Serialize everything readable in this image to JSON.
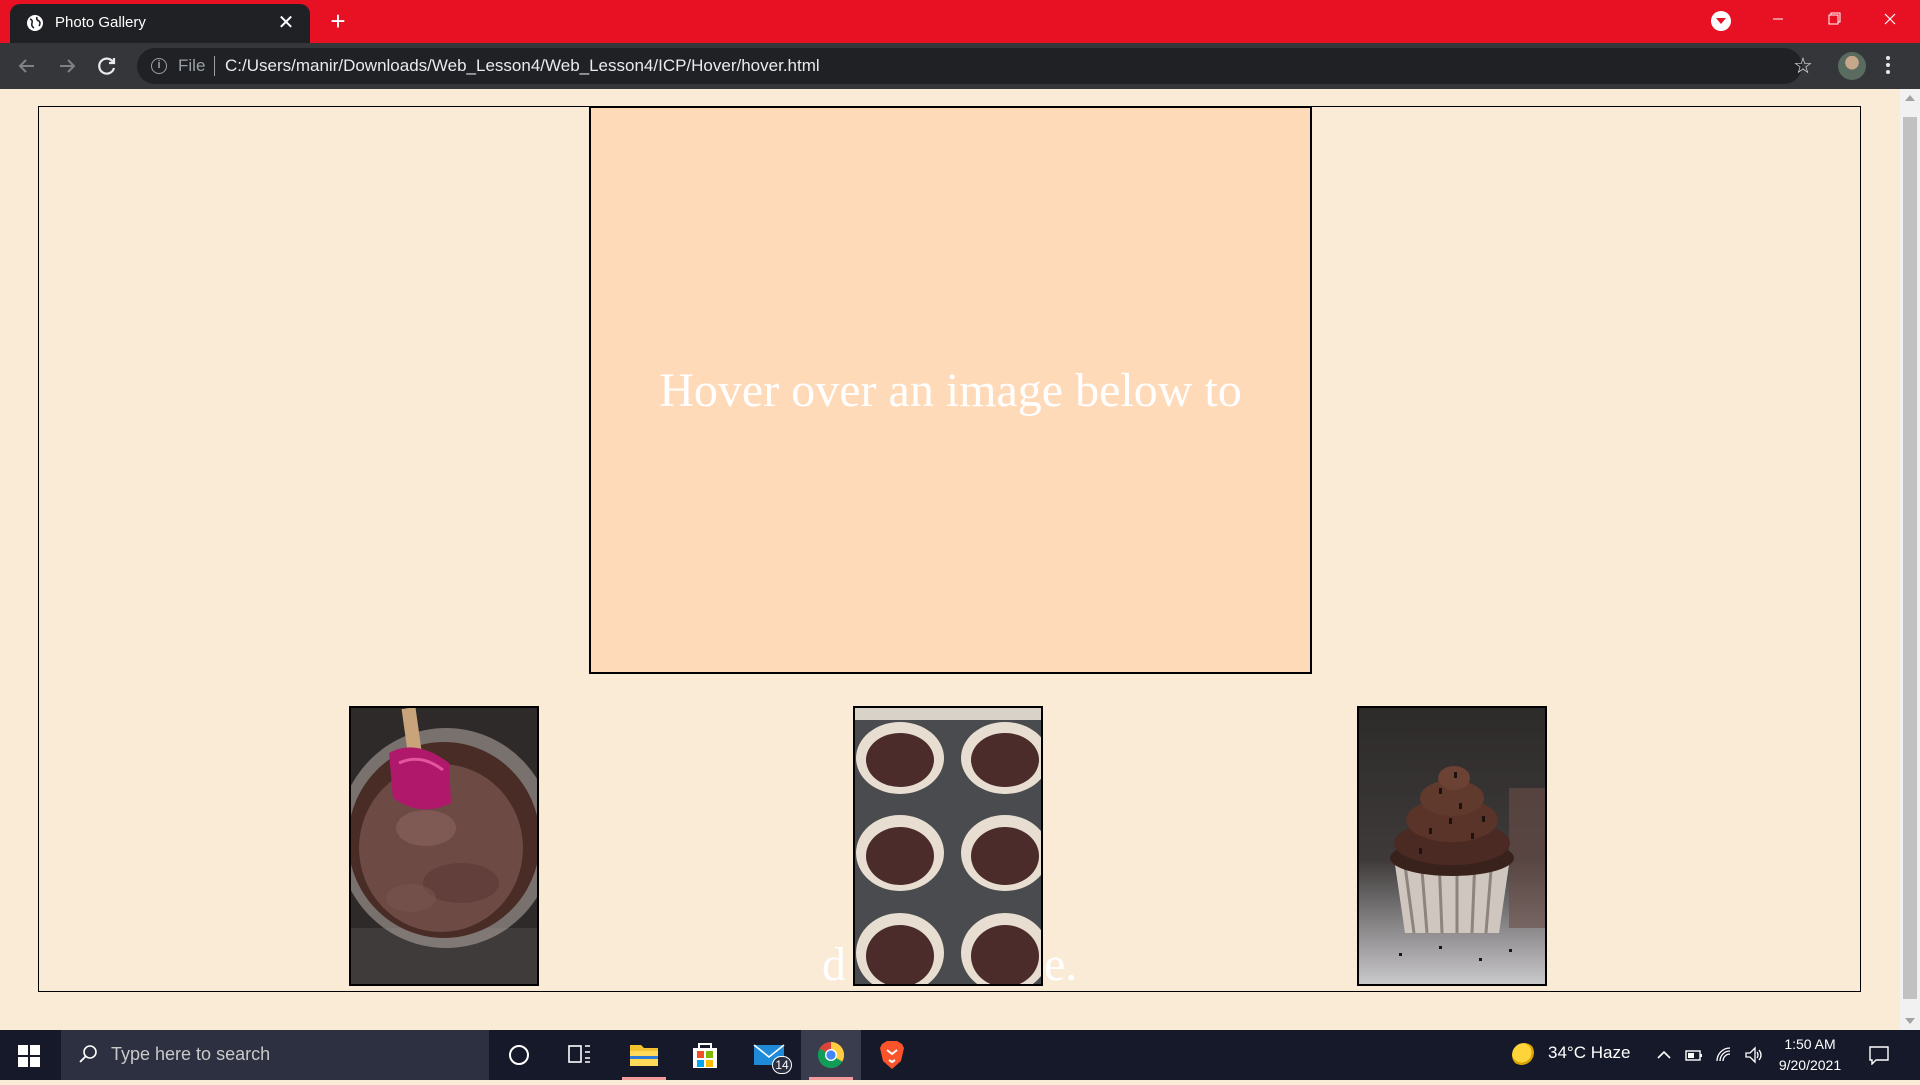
{
  "browser": {
    "tab_title": "Photo Gallery",
    "tab_close": "✕",
    "new_tab": "+",
    "address_scheme": "File",
    "address_url": "C:/Users/manir/Downloads/Web_Lesson4/Web_Lesson4/ICP/Hover/hover.html",
    "star": "☆",
    "colors": {
      "frame": "#e81123",
      "toolbar": "#35363a",
      "omnibox": "#202124"
    }
  },
  "page": {
    "preview_text": "Hover over an image below to",
    "overflow_left": "d",
    "overflow_right": "e.",
    "colors": {
      "background": "#faebd7",
      "preview": "#ffdab9",
      "text": "#ffffff"
    },
    "thumbnails": [
      {
        "subject": "batter-bowl-with-spatula"
      },
      {
        "subject": "muffin-tin-with-batter"
      },
      {
        "subject": "frosted-chocolate-cupcake"
      }
    ]
  },
  "taskbar": {
    "search_placeholder": "Type here to search",
    "mail_badge": "14",
    "weather": "34°C  Haze",
    "time": "1:50 AM",
    "date": "9/20/2021"
  }
}
